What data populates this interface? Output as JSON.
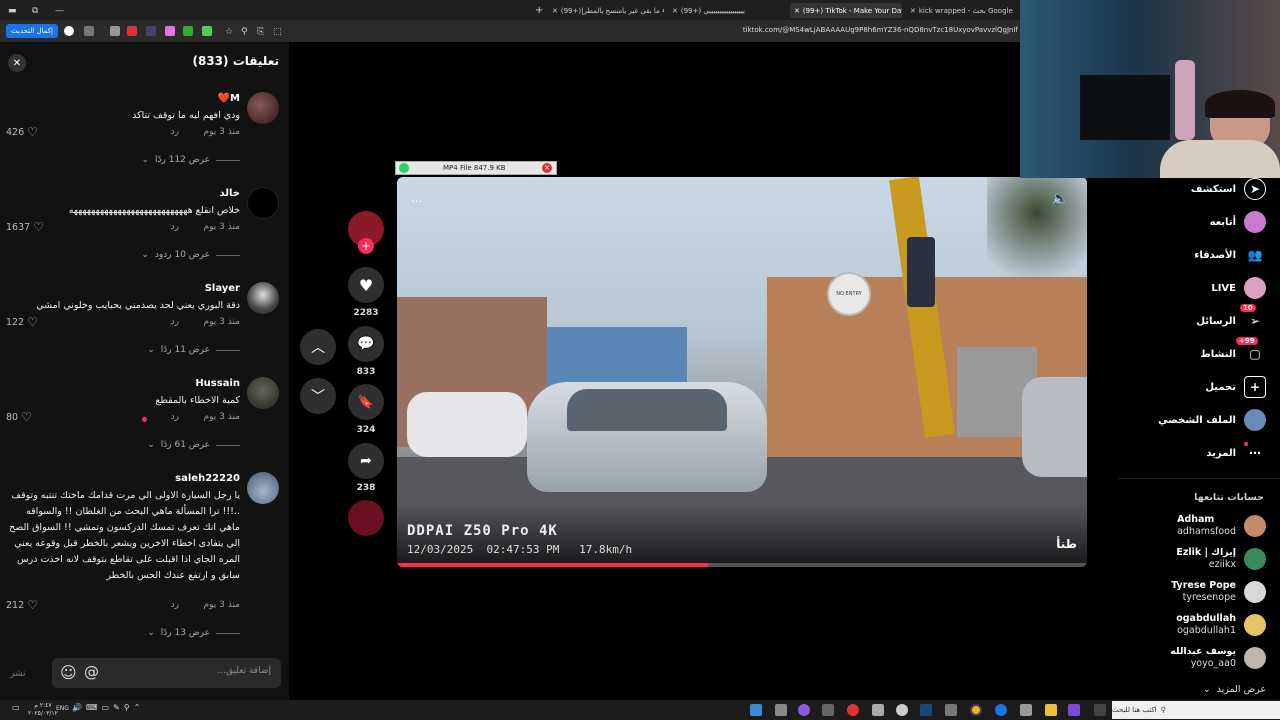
{
  "browser": {
    "tabs": [
      {
        "label": "(99+)|ما بقى غير يامنسح بالمطر 😂",
        "active": false
      },
      {
        "label": "(99+) يييييييييييييييييي",
        "active": false
      },
      {
        "label": "(99+) TikTok - Make Your Day",
        "active": true
      },
      {
        "label": "kick wrapped - بحث Google",
        "active": false
      }
    ],
    "new_tab": "+",
    "address": "tiktok.com/@MS4wLjABAAAAUg9P8h6mYZ36-nQD8nvTzc18UxyovPavvzlQgJnIf",
    "connect_label": "إكمال التحديث"
  },
  "comments": {
    "title": "تعليقات (833)",
    "close": "✕",
    "items": [
      {
        "name": "M❤️",
        "text": "ودي افهم ليه ما توقف تتاكد",
        "time": "منذ 3 يوم",
        "reply": "رد",
        "likes": "426",
        "more": "عرض 112 ردًا"
      },
      {
        "name": "خالد",
        "text": "خلاص انقلع هههههههههههههههههههههههههههه",
        "time": "منذ 3 يوم",
        "reply": "رد",
        "likes": "1637",
        "more": "عرض 10 ردود"
      },
      {
        "name": "Slayer",
        "text": "دقة البوري يعني لحد يصدمني يحبايب وخلوني امشي",
        "time": "منذ 3 يوم",
        "reply": "رد",
        "likes": "122",
        "more": "عرض 11 ردًا"
      },
      {
        "name": "Hussain",
        "text": "كمية الاخطاء بالمقطع",
        "time": "منذ 3 يوم",
        "reply": "رد",
        "likes": "80",
        "more": "عرض 61 ردًا"
      },
      {
        "name": "saleh22220",
        "text": "يا رجل السيارة الاولى الي مرت قدامك ماختك تنتبه وتوقف ..!!! ترا المسألة ماهي البحث من الغلطان !! والسواقه ماهي انك تعرف تمسك الدركسون وتمشي !! السواق الصح الي يتفادى اخطاء الاخرين ويشعر بالخطر قبل وقوعه يعني المره الجاي اذا اقبلت على تقاطع بتوقف لانه اخذت درس سابق و ارتفع عندك الحس بالخطر",
        "time": "منذ 3 يوم",
        "reply": "رد",
        "likes": "212",
        "more": "عرض 13 ردًا"
      }
    ],
    "input_placeholder": "إضافة تعليق...",
    "post_label": "نشر",
    "emoji": "☺",
    "mention": "@"
  },
  "video": {
    "menu": "...",
    "brand": "DDPAI Z50 Pro 4K",
    "timestamp": "12/03/2025  02:47:53 PM   17.8km/h",
    "caption_tag": "طنأ",
    "sign": "NO ENTRY",
    "progress": 0.45
  },
  "popup": {
    "label": "MP4 File 847.9 KB"
  },
  "actions": {
    "likes": "2283",
    "comments": "833",
    "saves": "324",
    "shares": "238"
  },
  "nav": {
    "items": [
      {
        "label": "استكشف",
        "icon": "compass-icon"
      },
      {
        "label": "أتابعه",
        "icon": "avatar-icon"
      },
      {
        "label": "الأصدقاء",
        "icon": "friends-icon"
      },
      {
        "label": "LIVE",
        "icon": "live-icon"
      },
      {
        "label": "الرسائل",
        "icon": "messages-icon",
        "badge": "10"
      },
      {
        "label": "النشاط",
        "icon": "activity-icon",
        "badge": "99+"
      },
      {
        "label": "تحميل",
        "icon": "upload-icon"
      },
      {
        "label": "الملف الشخصي",
        "icon": "profile-icon"
      },
      {
        "label": "المزيد",
        "icon": "more-icon"
      }
    ],
    "following_title": "حسابات تتابعها",
    "accounts": [
      {
        "name": "Adham",
        "handle": "adhamsfood",
        "color": "#c58a6a"
      },
      {
        "name": "Ezlik | إيزاك",
        "handle": "eziikx",
        "color": "#3a8a5a"
      },
      {
        "name": "Tyrese Pope",
        "handle": "tyresenope",
        "color": "#d9d9d9"
      },
      {
        "name": "ogabdullah",
        "handle": "ogabdullah1",
        "color": "#e6c36a"
      },
      {
        "name": "يوسف عبدالله",
        "handle": "yoyo_aa0",
        "color": "#bfb5aa"
      }
    ],
    "see_more": "عرض المزيد"
  },
  "taskbar": {
    "search_placeholder": "اكتب هنا للبحث",
    "lang": "ENG",
    "time": "٢:٤٧ م",
    "date": "٢٠٢٥/٠٣/١٢"
  },
  "colors": {
    "accent": "#fe2c55",
    "panel": "#121212",
    "button": "#2f2f2f"
  }
}
